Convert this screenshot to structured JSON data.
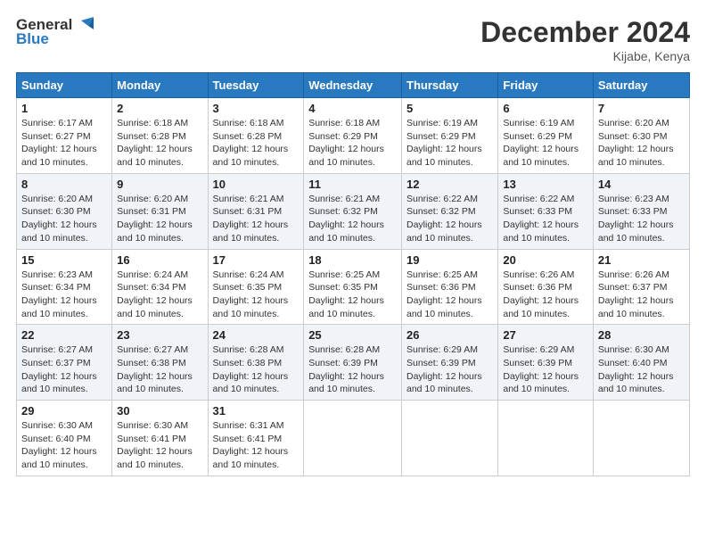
{
  "logo": {
    "line1": "General",
    "line2": "Blue"
  },
  "title": "December 2024",
  "location": "Kijabe, Kenya",
  "days_of_week": [
    "Sunday",
    "Monday",
    "Tuesday",
    "Wednesday",
    "Thursday",
    "Friday",
    "Saturday"
  ],
  "weeks": [
    [
      {
        "day": "1",
        "sunrise": "6:17 AM",
        "sunset": "6:27 PM",
        "daylight": "Daylight: 12 hours and 10 minutes."
      },
      {
        "day": "2",
        "sunrise": "6:18 AM",
        "sunset": "6:28 PM",
        "daylight": "Daylight: 12 hours and 10 minutes."
      },
      {
        "day": "3",
        "sunrise": "6:18 AM",
        "sunset": "6:28 PM",
        "daylight": "Daylight: 12 hours and 10 minutes."
      },
      {
        "day": "4",
        "sunrise": "6:18 AM",
        "sunset": "6:29 PM",
        "daylight": "Daylight: 12 hours and 10 minutes."
      },
      {
        "day": "5",
        "sunrise": "6:19 AM",
        "sunset": "6:29 PM",
        "daylight": "Daylight: 12 hours and 10 minutes."
      },
      {
        "day": "6",
        "sunrise": "6:19 AM",
        "sunset": "6:29 PM",
        "daylight": "Daylight: 12 hours and 10 minutes."
      },
      {
        "day": "7",
        "sunrise": "6:20 AM",
        "sunset": "6:30 PM",
        "daylight": "Daylight: 12 hours and 10 minutes."
      }
    ],
    [
      {
        "day": "8",
        "sunrise": "6:20 AM",
        "sunset": "6:30 PM",
        "daylight": "Daylight: 12 hours and 10 minutes."
      },
      {
        "day": "9",
        "sunrise": "6:20 AM",
        "sunset": "6:31 PM",
        "daylight": "Daylight: 12 hours and 10 minutes."
      },
      {
        "day": "10",
        "sunrise": "6:21 AM",
        "sunset": "6:31 PM",
        "daylight": "Daylight: 12 hours and 10 minutes."
      },
      {
        "day": "11",
        "sunrise": "6:21 AM",
        "sunset": "6:32 PM",
        "daylight": "Daylight: 12 hours and 10 minutes."
      },
      {
        "day": "12",
        "sunrise": "6:22 AM",
        "sunset": "6:32 PM",
        "daylight": "Daylight: 12 hours and 10 minutes."
      },
      {
        "day": "13",
        "sunrise": "6:22 AM",
        "sunset": "6:33 PM",
        "daylight": "Daylight: 12 hours and 10 minutes."
      },
      {
        "day": "14",
        "sunrise": "6:23 AM",
        "sunset": "6:33 PM",
        "daylight": "Daylight: 12 hours and 10 minutes."
      }
    ],
    [
      {
        "day": "15",
        "sunrise": "6:23 AM",
        "sunset": "6:34 PM",
        "daylight": "Daylight: 12 hours and 10 minutes."
      },
      {
        "day": "16",
        "sunrise": "6:24 AM",
        "sunset": "6:34 PM",
        "daylight": "Daylight: 12 hours and 10 minutes."
      },
      {
        "day": "17",
        "sunrise": "6:24 AM",
        "sunset": "6:35 PM",
        "daylight": "Daylight: 12 hours and 10 minutes."
      },
      {
        "day": "18",
        "sunrise": "6:25 AM",
        "sunset": "6:35 PM",
        "daylight": "Daylight: 12 hours and 10 minutes."
      },
      {
        "day": "19",
        "sunrise": "6:25 AM",
        "sunset": "6:36 PM",
        "daylight": "Daylight: 12 hours and 10 minutes."
      },
      {
        "day": "20",
        "sunrise": "6:26 AM",
        "sunset": "6:36 PM",
        "daylight": "Daylight: 12 hours and 10 minutes."
      },
      {
        "day": "21",
        "sunrise": "6:26 AM",
        "sunset": "6:37 PM",
        "daylight": "Daylight: 12 hours and 10 minutes."
      }
    ],
    [
      {
        "day": "22",
        "sunrise": "6:27 AM",
        "sunset": "6:37 PM",
        "daylight": "Daylight: 12 hours and 10 minutes."
      },
      {
        "day": "23",
        "sunrise": "6:27 AM",
        "sunset": "6:38 PM",
        "daylight": "Daylight: 12 hours and 10 minutes."
      },
      {
        "day": "24",
        "sunrise": "6:28 AM",
        "sunset": "6:38 PM",
        "daylight": "Daylight: 12 hours and 10 minutes."
      },
      {
        "day": "25",
        "sunrise": "6:28 AM",
        "sunset": "6:39 PM",
        "daylight": "Daylight: 12 hours and 10 minutes."
      },
      {
        "day": "26",
        "sunrise": "6:29 AM",
        "sunset": "6:39 PM",
        "daylight": "Daylight: 12 hours and 10 minutes."
      },
      {
        "day": "27",
        "sunrise": "6:29 AM",
        "sunset": "6:39 PM",
        "daylight": "Daylight: 12 hours and 10 minutes."
      },
      {
        "day": "28",
        "sunrise": "6:30 AM",
        "sunset": "6:40 PM",
        "daylight": "Daylight: 12 hours and 10 minutes."
      }
    ],
    [
      {
        "day": "29",
        "sunrise": "6:30 AM",
        "sunset": "6:40 PM",
        "daylight": "Daylight: 12 hours and 10 minutes."
      },
      {
        "day": "30",
        "sunrise": "6:30 AM",
        "sunset": "6:41 PM",
        "daylight": "Daylight: 12 hours and 10 minutes."
      },
      {
        "day": "31",
        "sunrise": "6:31 AM",
        "sunset": "6:41 PM",
        "daylight": "Daylight: 12 hours and 10 minutes."
      },
      null,
      null,
      null,
      null
    ]
  ]
}
